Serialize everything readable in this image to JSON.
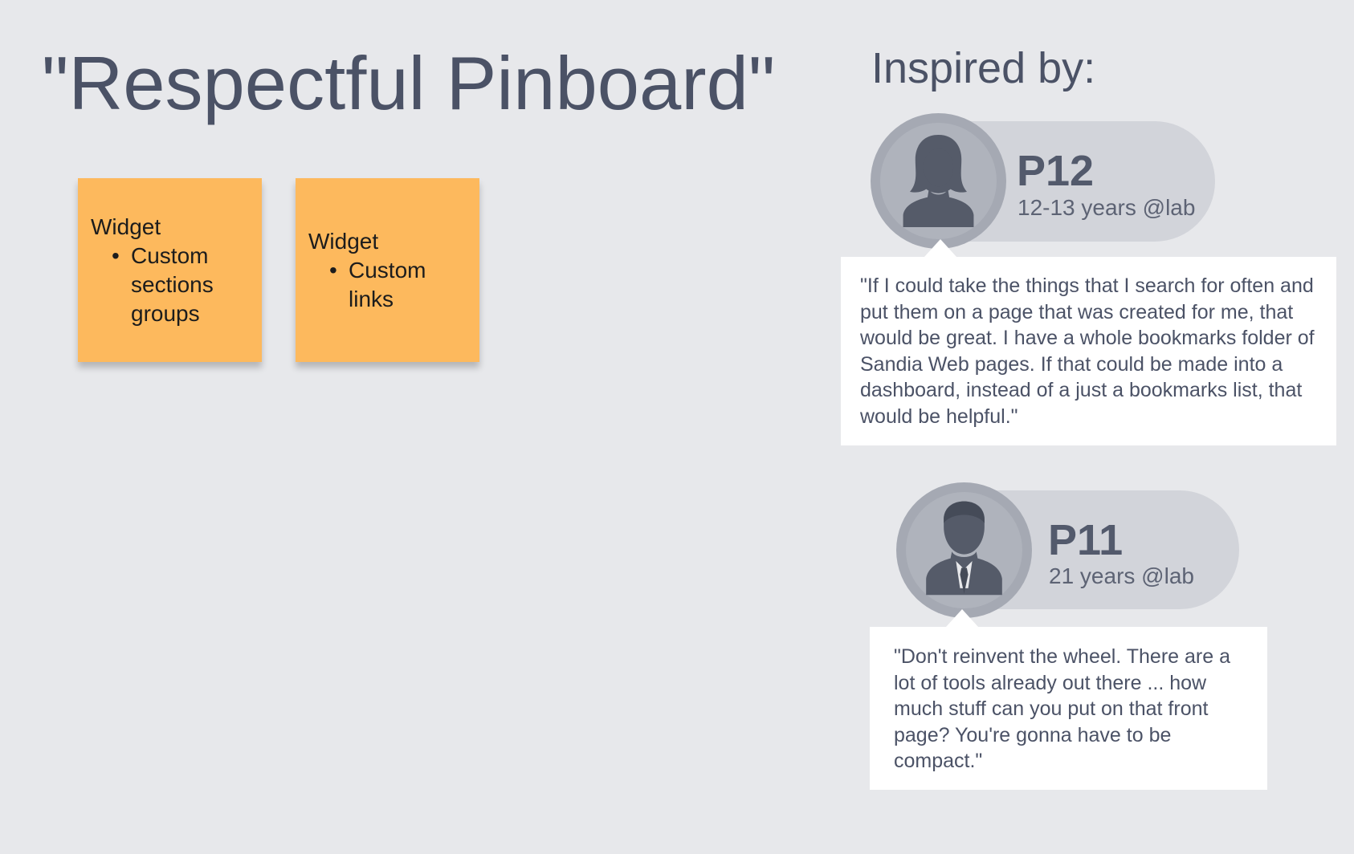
{
  "board": {
    "title": "\"Respectful Pinboard\""
  },
  "sticky_notes": [
    {
      "heading": "Widget",
      "bullet_lines": [
        "Custom",
        "sections",
        "groups"
      ]
    },
    {
      "heading": "Widget",
      "bullet_lines": [
        "Custom",
        "links"
      ]
    }
  ],
  "inspiration": {
    "title": "Inspired by:",
    "personas": [
      {
        "id": "P12",
        "meta": "12-13 years @lab",
        "avatar_icon": "female-user-icon",
        "quote": "\"If I could take the things that I search for often and put them on a page that was created for me, that would be great. I have a whole bookmarks folder of Sandia Web pages. If that could be made into a dashboard, instead of a just a bookmarks list, that would be helpful.\""
      },
      {
        "id": "P11",
        "meta": "21 years @lab",
        "avatar_icon": "male-user-icon",
        "quote": "\"Don't reinvent the wheel. There are a lot of tools already out there ... how much stuff can you put on that front page? You're gonna have to be compact.\""
      }
    ]
  },
  "colors": {
    "background": "#e7e8eb",
    "sticky_note": "#fdb95d",
    "heading_text": "#4b5266",
    "persona_pill": "#d2d4da",
    "avatar_circle": "#a5a9b3",
    "avatar_figure": "#555b69",
    "quote_box": "#ffffff"
  }
}
